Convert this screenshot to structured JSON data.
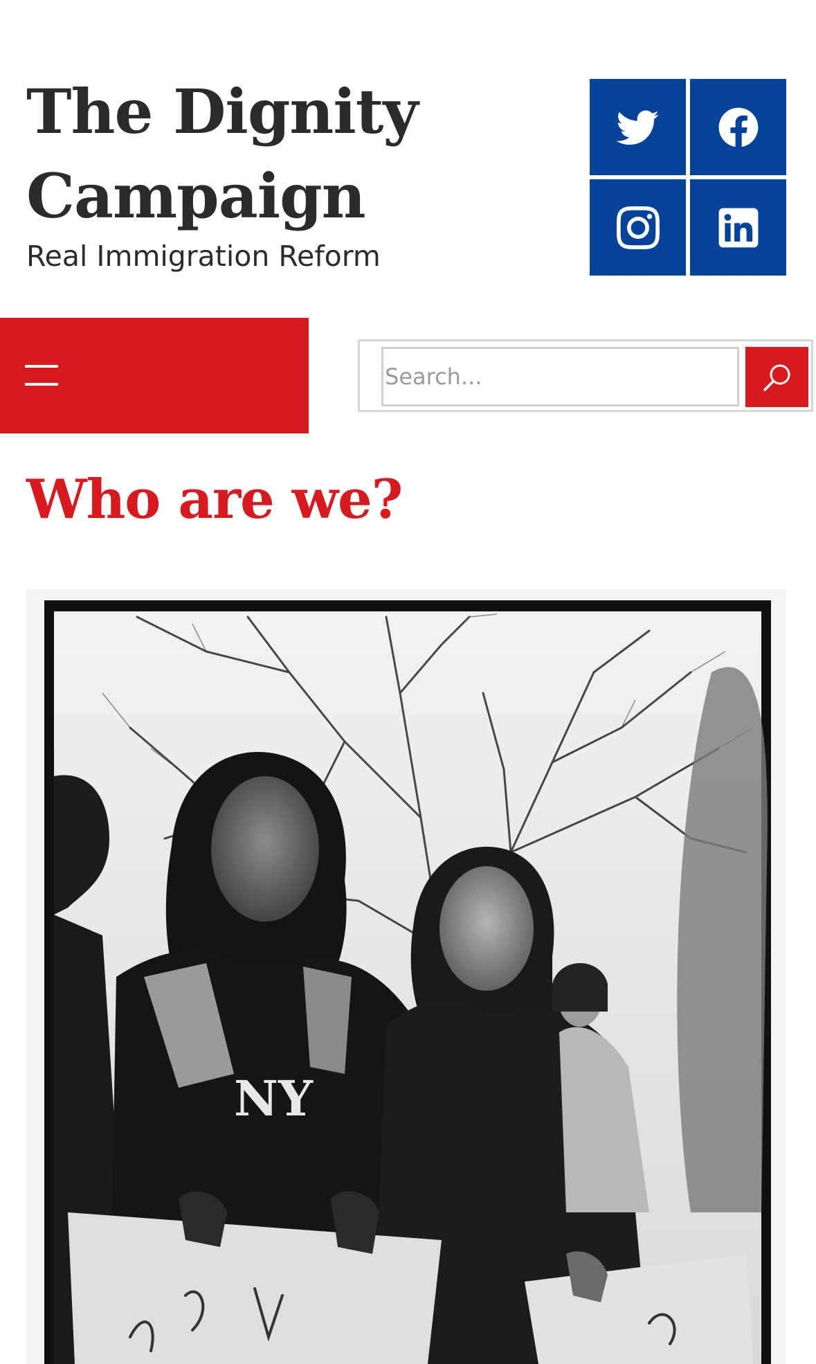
{
  "header": {
    "title": "The Dignity Campaign",
    "tagline": "Real Immigration Reform"
  },
  "social": [
    {
      "name": "twitter",
      "icon": "twitter-icon"
    },
    {
      "name": "facebook",
      "icon": "facebook-icon"
    },
    {
      "name": "instagram",
      "icon": "instagram-icon"
    },
    {
      "name": "linkedin",
      "icon": "linkedin-icon"
    }
  ],
  "nav": {
    "menu_icon": "hamburger-menu-icon"
  },
  "search": {
    "placeholder": "Search...",
    "value": "",
    "button_icon": "search-icon"
  },
  "main": {
    "heading": "Who are we?",
    "photo": {
      "description_icon": "protest-photo"
    }
  },
  "colors": {
    "brand_red": "#d71920",
    "social_blue": "#05439a",
    "text_dark": "#2b2b2b"
  }
}
